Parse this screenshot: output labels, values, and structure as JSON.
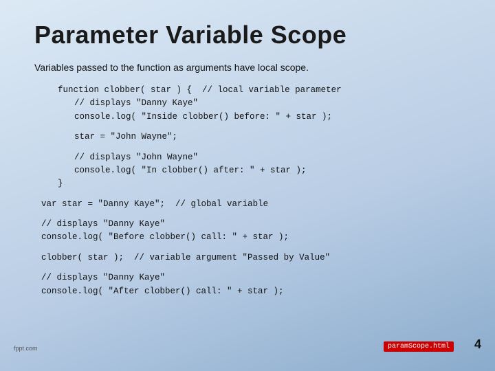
{
  "slide": {
    "title": "Parameter Variable Scope",
    "subtitle": "Variables passed to the function as arguments have local scope.",
    "code_lines": [
      {
        "indent": 1,
        "text": "function clobber( star ) {  // local variable parameter"
      },
      {
        "indent": 2,
        "text": "// displays \"Danny Kaye\""
      },
      {
        "indent": 2,
        "text": "console.log( \"Inside clobber() before: \" + star );"
      },
      {
        "indent": 0,
        "text": ""
      },
      {
        "indent": 2,
        "text": "star = \"John Wayne\";"
      },
      {
        "indent": 0,
        "text": ""
      },
      {
        "indent": 2,
        "text": "// displays \"John Wayne\""
      },
      {
        "indent": 2,
        "text": "console.log( \"In clobber() after: \" + star );"
      },
      {
        "indent": 1,
        "text": "}"
      },
      {
        "indent": 0,
        "text": ""
      },
      {
        "indent": 0,
        "text": "var star = \"Danny Kaye\";  // global variable"
      },
      {
        "indent": 0,
        "text": ""
      },
      {
        "indent": 0,
        "text": "// displays \"Danny Kaye\""
      },
      {
        "indent": 0,
        "text": "console.log( \"Before clobber() call: \" + star );"
      },
      {
        "indent": 0,
        "text": ""
      },
      {
        "indent": 0,
        "text": "clobber( star );  // variable argument \"Passed by Value\""
      },
      {
        "indent": 0,
        "text": ""
      },
      {
        "indent": 0,
        "text": "// displays \"Danny Kaye\""
      },
      {
        "indent": 0,
        "text": "console.log( \"After clobber() call: \" + star );"
      }
    ],
    "filename_badge": "paramScope.html",
    "slide_number": "4",
    "logo": "fppt.com"
  }
}
